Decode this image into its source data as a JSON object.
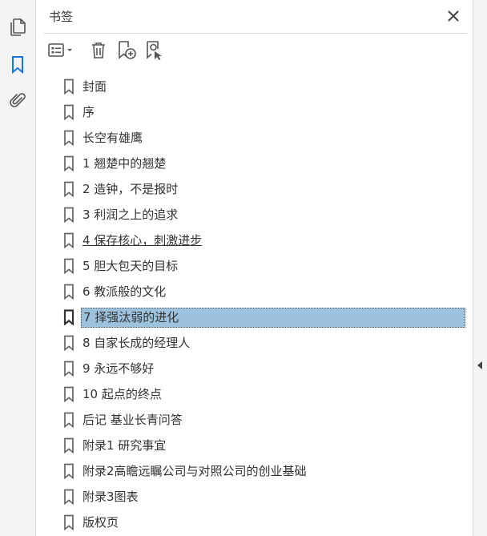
{
  "left_rail": {
    "items": [
      {
        "name": "pages-icon"
      },
      {
        "name": "bookmarks-icon",
        "active": true
      },
      {
        "name": "attachments-icon"
      }
    ],
    "active_color": "#1473e6"
  },
  "panel": {
    "title": "书签",
    "close_icon": "close-icon"
  },
  "toolbar": {
    "buttons": [
      "options-menu-icon",
      "delete-bookmark-icon",
      "new-bookmark-icon",
      "find-current-bookmark-icon"
    ]
  },
  "bookmarks": [
    {
      "label": "封面"
    },
    {
      "label": "序"
    },
    {
      "label": "长空有雄鹰"
    },
    {
      "label": "1 翘楚中的翘楚"
    },
    {
      "label": "2 造钟，不是报时"
    },
    {
      "label": "3 利润之上的追求"
    },
    {
      "label": "4 保存核心，刺激进步",
      "underlined": true
    },
    {
      "label": "5 胆大包天的目标"
    },
    {
      "label": "6 教派般的文化"
    },
    {
      "label": "7 择强汰弱的进化",
      "selected": true
    },
    {
      "label": "8 自家长成的经理人"
    },
    {
      "label": "9 永远不够好"
    },
    {
      "label": "10 起点的终点"
    },
    {
      "label": "后记 基业长青问答"
    },
    {
      "label": "附录1 研究事宜"
    },
    {
      "label": "附录2高瞻远瞩公司与对照公司的创业基础"
    },
    {
      "label": "附录3图表"
    },
    {
      "label": "版权页"
    }
  ],
  "colors": {
    "selection": "#9cc2dd",
    "rail_bg": "#f4f4f4"
  }
}
